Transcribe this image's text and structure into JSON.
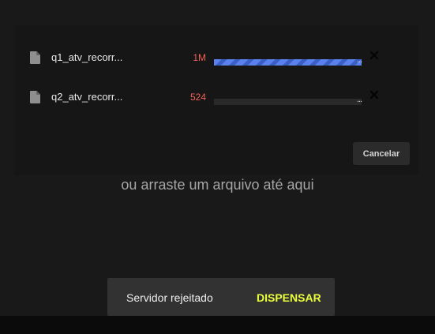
{
  "files": [
    {
      "name": "q1_atv_recorr...",
      "size": "1M",
      "progress_fraction": 1.0,
      "progress_dots": "..."
    },
    {
      "name": "q2_atv_recorr...",
      "size": "524",
      "progress_fraction": 0.0,
      "progress_dots": "..."
    }
  ],
  "icons": {
    "file": "file-icon",
    "remove": "close-icon"
  },
  "cancel_label": "Cancelar",
  "drop_hint": "ou arraste um arquivo até aqui",
  "snackbar": {
    "message": "Servidor rejeitado",
    "action": "DISPENSAR"
  },
  "colors": {
    "background": "#191919",
    "size_text": "#f0625b",
    "progress": "#5a82ec",
    "snackbar_action": "#eaff3a"
  }
}
